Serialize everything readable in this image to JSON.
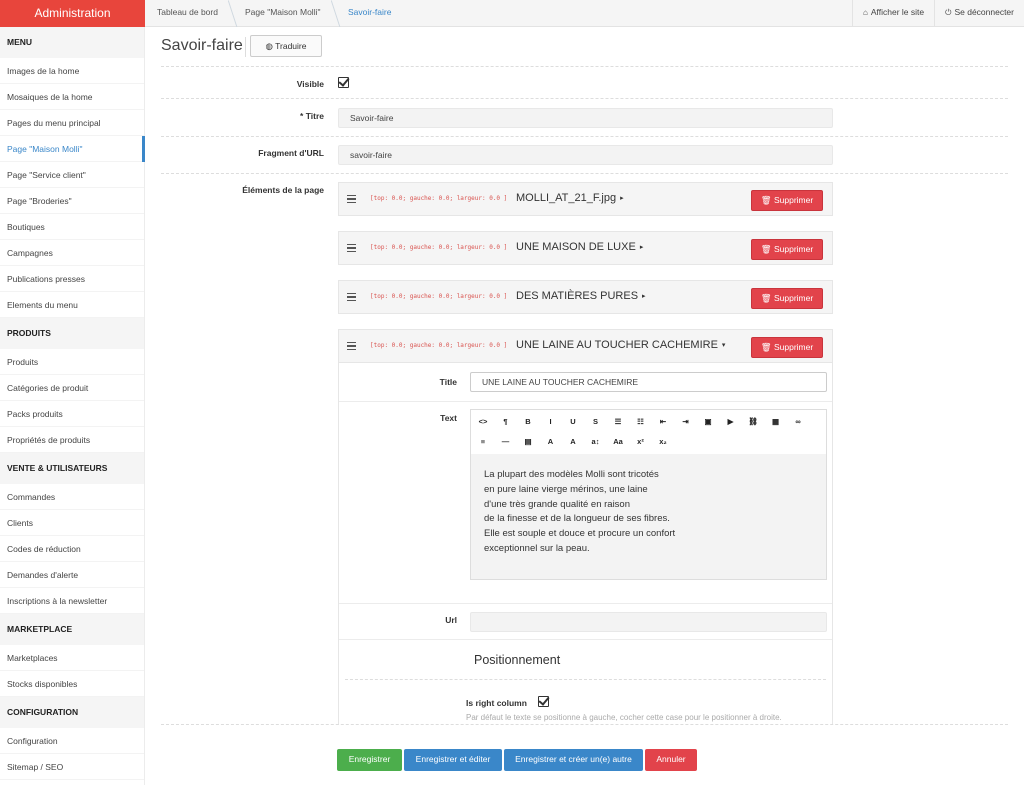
{
  "brand": "Administration",
  "breadcrumb": [
    "Tableau de bord",
    "Page \"Maison Molli\"",
    "Savoir-faire"
  ],
  "topright": {
    "view_site": "Afficher le site",
    "logout": "Se déconnecter"
  },
  "sidebar": [
    {
      "type": "head",
      "label": "MENU"
    },
    {
      "type": "item",
      "label": "Images de la home"
    },
    {
      "type": "item",
      "label": "Mosaiques de la home"
    },
    {
      "type": "item",
      "label": "Pages du menu principal"
    },
    {
      "type": "item",
      "label": "Page \"Maison Molli\"",
      "active": true
    },
    {
      "type": "item",
      "label": "Page \"Service client\""
    },
    {
      "type": "item",
      "label": "Page \"Broderies\""
    },
    {
      "type": "item",
      "label": "Boutiques"
    },
    {
      "type": "item",
      "label": "Campagnes"
    },
    {
      "type": "item",
      "label": "Publications presses"
    },
    {
      "type": "item",
      "label": "Elements du menu"
    },
    {
      "type": "head",
      "label": "PRODUITS"
    },
    {
      "type": "item",
      "label": "Produits"
    },
    {
      "type": "item",
      "label": "Catégories de produit"
    },
    {
      "type": "item",
      "label": "Packs produits"
    },
    {
      "type": "item",
      "label": "Propriétés de produits"
    },
    {
      "type": "head",
      "label": "VENTE & UTILISATEURS"
    },
    {
      "type": "item",
      "label": "Commandes"
    },
    {
      "type": "item",
      "label": "Clients"
    },
    {
      "type": "item",
      "label": "Codes de réduction"
    },
    {
      "type": "item",
      "label": "Demandes d'alerte"
    },
    {
      "type": "item",
      "label": "Inscriptions à la newsletter"
    },
    {
      "type": "head",
      "label": "MARKETPLACE"
    },
    {
      "type": "item",
      "label": "Marketplaces"
    },
    {
      "type": "item",
      "label": "Stocks disponibles"
    },
    {
      "type": "head",
      "label": "CONFIGURATION"
    },
    {
      "type": "item",
      "label": "Configuration"
    },
    {
      "type": "item",
      "label": "Sitemap / SEO"
    }
  ],
  "page": {
    "title": "Savoir-faire",
    "translate_label": "Traduire",
    "visible_label": "Visible",
    "visible_checked": true,
    "titre_label": "Titre",
    "titre_required_mark": "*",
    "titre_value": "Savoir-faire",
    "url_fragment_label": "Fragment d'URL",
    "url_fragment_value": "savoir-faire",
    "elements_label": "Éléments de la page"
  },
  "elements": [
    {
      "coords": "[top: 0.0; gauche: 0.0; largeur: 0.0 ]",
      "name": "MOLLI_AT_21_F.jpg",
      "caret": "▸",
      "delete_label": "Supprimer"
    },
    {
      "coords": "[top: 0.0; gauche: 0.0; largeur: 0.0 ]",
      "name": "UNE MAISON DE LUXE",
      "caret": "▸",
      "delete_label": "Supprimer"
    },
    {
      "coords": "[top: 0.0; gauche: 0.0; largeur: 0.0 ]",
      "name": "DES MATIÈRES PURES",
      "caret": "▸",
      "delete_label": "Supprimer"
    },
    {
      "coords": "[top: 0.0; gauche: 0.0; largeur: 0.0 ]",
      "name": "UNE LAINE AU TOUCHER CACHEMIRE",
      "caret": "▾",
      "delete_label": "Supprimer"
    }
  ],
  "expanded": {
    "title_label": "Title",
    "title_value": "UNE LAINE AU TOUCHER CACHEMIRE",
    "text_label": "Text",
    "toolbar_row1": [
      "<>",
      "¶",
      "B",
      "I",
      "U",
      "S",
      "☰",
      "☷",
      "⇤",
      "⇥",
      "▣",
      "▶",
      "⛓",
      "▦",
      "∞"
    ],
    "toolbar_row2": [
      "≡",
      "—",
      "▤",
      "A",
      "A",
      "a↕",
      "Aa",
      "x²",
      "x₂"
    ],
    "body_lines": [
      "La plupart des modèles Molli sont tricotés",
      "en pure laine vierge mérinos, une laine",
      "d'une très grande qualité en raison",
      "de la finesse et de la longueur de ses fibres.",
      "Elle est souple et douce et procure un confort",
      "exceptionnel sur la peau."
    ],
    "url_label": "Url",
    "url_value": "",
    "positioning_title": "Positionnement",
    "right_column_label": "Is right column",
    "right_column_checked": true,
    "hint": "Par défaut le texte se positionne à gauche, cocher cette case pour le positionner à droite."
  },
  "actions": [
    {
      "label": "Enregistrer",
      "color": "#4cae4c"
    },
    {
      "label": "Enregistrer et éditer",
      "color": "#3a87c9"
    },
    {
      "label": "Enregistrer et créer un(e) autre",
      "color": "#3a87c9"
    },
    {
      "label": "Annuler",
      "color": "#e2434b"
    }
  ]
}
